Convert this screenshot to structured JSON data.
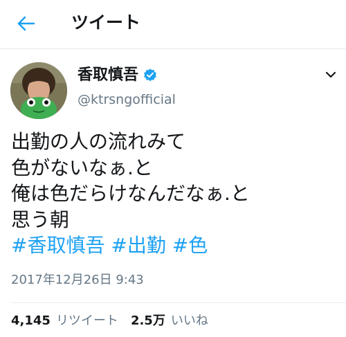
{
  "colors": {
    "accent": "#1da1f2",
    "text": "#14171a",
    "muted": "#657786",
    "divider": "#e6ecf0"
  },
  "header": {
    "back_icon": "arrow-left-icon",
    "title": "ツイート"
  },
  "author": {
    "display_name": "香取慎吾",
    "verified_icon": "verified-badge-icon",
    "handle": "@ktrsngofficial",
    "menu_icon": "chevron-down-icon"
  },
  "tweet": {
    "lines": [
      "出勤の人の流れみて",
      "色がないなぁ.と",
      "俺は色だらけなんだなぁ.と",
      "思う朝"
    ],
    "hashtags": [
      "#香取慎吾",
      "#出勤",
      "#色"
    ],
    "timestamp": "2017年12月26日 9:43"
  },
  "stats": {
    "retweet_count": "4,145",
    "retweet_label": "リツイート",
    "like_count": "2.5万",
    "like_label": "いいね"
  }
}
